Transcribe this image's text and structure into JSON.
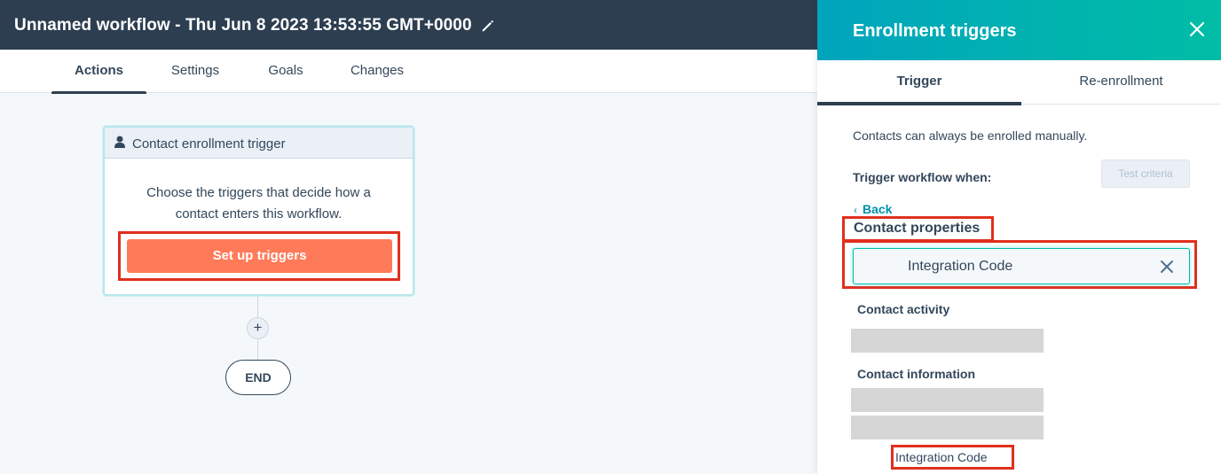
{
  "workflow": {
    "title": "Unnamed workflow - Thu Jun 8 2023 13:53:55 GMT+0000"
  },
  "tabs": [
    "Actions",
    "Settings",
    "Goals",
    "Changes"
  ],
  "canvas": {
    "trigger_card": {
      "header": "Contact enrollment trigger",
      "description_line1": "Choose the triggers that decide how a",
      "description_line2": "contact enters this workflow.",
      "button": "Set up triggers"
    },
    "plus": "+",
    "end": "END"
  },
  "panel": {
    "title": "Enrollment triggers",
    "tabs": [
      "Trigger",
      "Re-enrollment"
    ],
    "manual_note": "Contacts can always be enrolled manually.",
    "trigger_when": "Trigger workflow when:",
    "test_criteria": "Test criteria",
    "back": "Back",
    "contact_properties": "Contact properties",
    "search_value": "Integration Code",
    "sections": {
      "activity": "Contact activity",
      "information": "Contact information"
    },
    "result_item": "Integration Code"
  },
  "colors": {
    "topbar": "#2d3e50",
    "accent_orange": "#ff7a59",
    "panel_gradient_start": "#00a4bd",
    "panel_gradient_end": "#00bda5",
    "highlight_red": "#e0301e",
    "link": "#0091ae"
  }
}
